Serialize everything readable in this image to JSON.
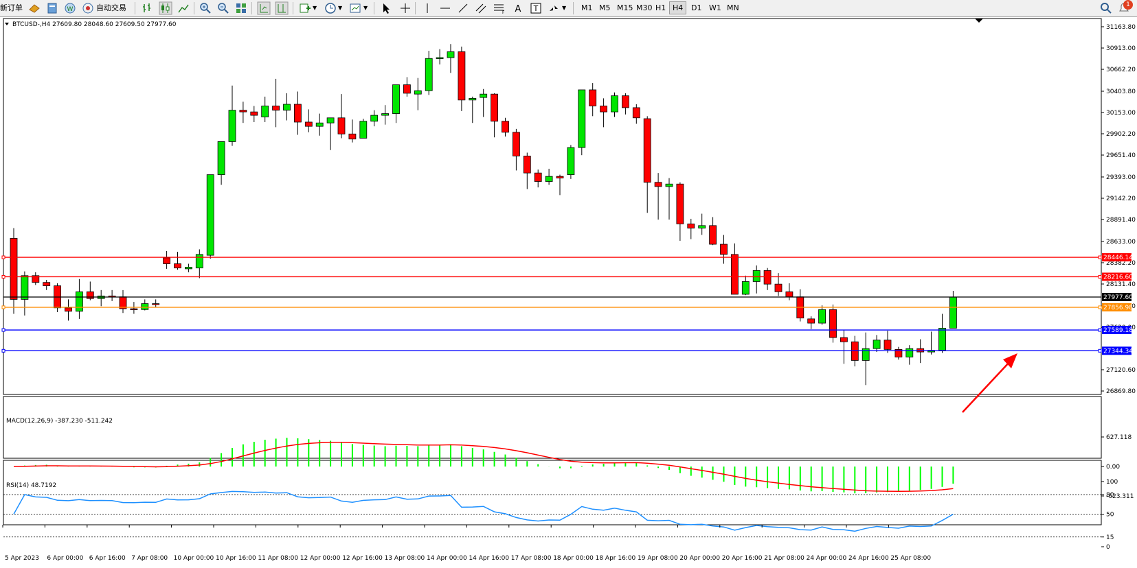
{
  "toolbar": {
    "new_order": "新订单",
    "autotrade": "自动交易",
    "periods": [
      "M1",
      "M5",
      "M15",
      "M30",
      "H1",
      "H4",
      "D1",
      "W1",
      "MN"
    ],
    "active_period": "H4",
    "notification_count": "1"
  },
  "chart": {
    "header": "BTCUSD-,H4  27609.80 28048.60 27609.50 27977.60",
    "price_axis": [
      "31163.80",
      "30913.00",
      "30662.20",
      "30403.80",
      "30153.00",
      "29902.20",
      "29651.40",
      "29393.00",
      "29142.20",
      "28891.40",
      "28633.00",
      "28382.20",
      "28131.40",
      "27872.60",
      "27620.00",
      "27120.60",
      "26869.80"
    ],
    "h_lines": [
      {
        "value": "28446.14",
        "color": "#ff0000"
      },
      {
        "value": "28216.60",
        "color": "#ff0000"
      },
      {
        "value": "27977.60",
        "color": "#000000"
      },
      {
        "value": "27856.98",
        "color": "#ff8c00"
      },
      {
        "value": "27589.18",
        "color": "#0000ff"
      },
      {
        "value": "27344.34",
        "color": "#0000ff"
      }
    ],
    "bull_color": "#00e600",
    "bear_color": "#ff0000"
  },
  "macd": {
    "label": "MACD(12,26,9) -387.230 -511.242",
    "axis": [
      "627.118",
      "0.00",
      "-623.311"
    ]
  },
  "rsi": {
    "label": "RSI(14) 48.7192",
    "axis": [
      "100",
      "80",
      "50",
      "15",
      "0"
    ]
  },
  "time_axis": [
    "5 Apr 2023",
    "6 Apr 00:00",
    "6 Apr 16:00",
    "7 Apr 08:00",
    "10 Apr 00:00",
    "10 Apr 16:00",
    "11 Apr 08:00",
    "12 Apr 00:00",
    "12 Apr 16:00",
    "13 Apr 08:00",
    "14 Apr 00:00",
    "14 Apr 16:00",
    "17 Apr 08:00",
    "18 Apr 00:00",
    "18 Apr 16:00",
    "19 Apr 08:00",
    "20 Apr 00:00",
    "20 Apr 16:00",
    "21 Apr 08:00",
    "24 Apr 00:00",
    "24 Apr 16:00",
    "25 Apr 08:00"
  ],
  "chart_data": {
    "type": "candlestick",
    "symbol": "BTCUSD-",
    "timeframe": "H4",
    "last": {
      "open": 27609.8,
      "high": 28048.6,
      "low": 27609.5,
      "close": 27977.6
    },
    "candles": [
      [
        28670,
        28790,
        27780,
        27950
      ],
      [
        27950,
        28280,
        27760,
        28230
      ],
      [
        28230,
        28270,
        28120,
        28150
      ],
      [
        28150,
        28180,
        28060,
        28110
      ],
      [
        28110,
        28140,
        27800,
        27850
      ],
      [
        27850,
        27950,
        27700,
        27810
      ],
      [
        27810,
        28190,
        27720,
        28040
      ],
      [
        28040,
        28160,
        27940,
        27960
      ],
      [
        27960,
        28060,
        27870,
        27990
      ],
      [
        27990,
        28060,
        27930,
        27980
      ],
      [
        27980,
        28060,
        27790,
        27840
      ],
      [
        27840,
        27920,
        27780,
        27830
      ],
      [
        27830,
        27950,
        27820,
        27900
      ],
      [
        27900,
        27950,
        27860,
        27890
      ],
      [
        28440,
        28520,
        28310,
        28370
      ],
      [
        28370,
        28510,
        28300,
        28320
      ],
      [
        28310,
        28370,
        28270,
        28330
      ],
      [
        28320,
        28540,
        28200,
        28480
      ],
      [
        28470,
        29420,
        28430,
        29420
      ],
      [
        29420,
        29710,
        29300,
        29810
      ],
      [
        29810,
        30470,
        29760,
        30180
      ],
      [
        30180,
        30280,
        30030,
        30160
      ],
      [
        30160,
        30230,
        30040,
        30120
      ],
      [
        30100,
        30340,
        30040,
        30230
      ],
      [
        30230,
        30550,
        29980,
        30180
      ],
      [
        30180,
        30380,
        30060,
        30250
      ],
      [
        30250,
        30400,
        29890,
        30040
      ],
      [
        30040,
        30190,
        29920,
        29990
      ],
      [
        29990,
        30140,
        29880,
        30030
      ],
      [
        30030,
        30050,
        29710,
        30090
      ],
      [
        30090,
        30370,
        29850,
        29900
      ],
      [
        29900,
        30070,
        29800,
        29840
      ],
      [
        29850,
        30080,
        29880,
        30050
      ],
      [
        30050,
        30180,
        29990,
        30120
      ],
      [
        30120,
        30240,
        30010,
        30140
      ],
      [
        30140,
        30480,
        30030,
        30480
      ],
      [
        30480,
        30570,
        30340,
        30380
      ],
      [
        30370,
        30560,
        30180,
        30410
      ],
      [
        30410,
        30880,
        30360,
        30790
      ],
      [
        30790,
        30900,
        30720,
        30800
      ],
      [
        30800,
        30960,
        30620,
        30870
      ],
      [
        30870,
        30930,
        30170,
        30300
      ],
      [
        30300,
        30340,
        30030,
        30320
      ],
      [
        30330,
        30430,
        30100,
        30370
      ],
      [
        30370,
        30380,
        29860,
        30050
      ],
      [
        30050,
        30090,
        29870,
        29920
      ],
      [
        29920,
        29960,
        29470,
        29640
      ],
      [
        29640,
        29680,
        29250,
        29440
      ],
      [
        29440,
        29480,
        29270,
        29340
      ],
      [
        29340,
        29490,
        29300,
        29400
      ],
      [
        29400,
        29420,
        29180,
        29380
      ],
      [
        29420,
        29770,
        29370,
        29740
      ],
      [
        29740,
        30410,
        29650,
        30420
      ],
      [
        30420,
        30500,
        30110,
        30230
      ],
      [
        30230,
        30320,
        29980,
        30160
      ],
      [
        30160,
        30390,
        30100,
        30350
      ],
      [
        30350,
        30380,
        30130,
        30210
      ],
      [
        30210,
        30250,
        30020,
        30090
      ],
      [
        30080,
        30110,
        28970,
        29330
      ],
      [
        29330,
        29440,
        28890,
        29280
      ],
      [
        29280,
        29380,
        28890,
        29310
      ],
      [
        29310,
        29330,
        28640,
        28840
      ],
      [
        28840,
        28900,
        28660,
        28790
      ],
      [
        28790,
        28960,
        28710,
        28820
      ],
      [
        28820,
        28920,
        28590,
        28600
      ],
      [
        28600,
        28710,
        28370,
        28480
      ],
      [
        28480,
        28610,
        28010,
        28010
      ],
      [
        28010,
        28230,
        28000,
        28160
      ],
      [
        28160,
        28350,
        28020,
        28290
      ],
      [
        28290,
        28320,
        28060,
        28130
      ],
      [
        28130,
        28260,
        27990,
        28040
      ],
      [
        28040,
        28140,
        27940,
        27980
      ],
      [
        27980,
        28070,
        27690,
        27730
      ],
      [
        27720,
        27750,
        27600,
        27670
      ],
      [
        27670,
        27880,
        27650,
        27830
      ],
      [
        27830,
        27890,
        27440,
        27500
      ],
      [
        27500,
        27590,
        27190,
        27450
      ],
      [
        27450,
        27520,
        27160,
        27230
      ],
      [
        27230,
        27560,
        26940,
        27370
      ],
      [
        27370,
        27530,
        27330,
        27470
      ],
      [
        27470,
        27580,
        27320,
        27360
      ],
      [
        27360,
        27390,
        27240,
        27270
      ],
      [
        27270,
        27410,
        27180,
        27370
      ],
      [
        27370,
        27480,
        27200,
        27330
      ],
      [
        27330,
        27570,
        27300,
        27350
      ],
      [
        27350,
        27780,
        27320,
        27610
      ],
      [
        27610,
        28050,
        27610,
        27978
      ]
    ]
  }
}
